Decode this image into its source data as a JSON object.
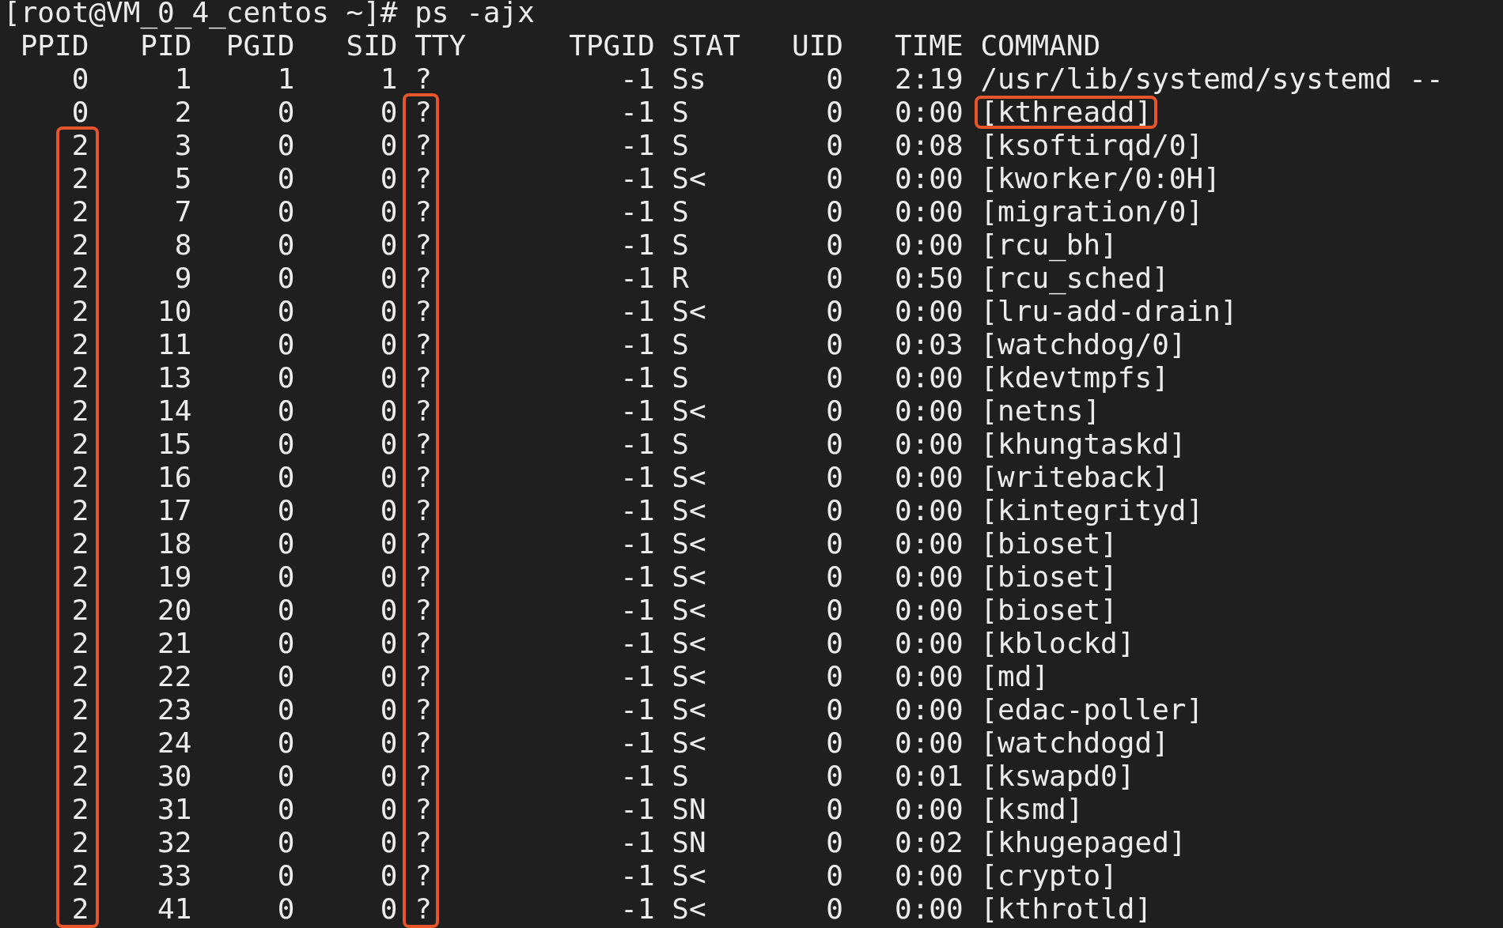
{
  "prompt": "[root@VM_0_4_centos ~]# ps -ajx",
  "columns": [
    "PPID",
    "PID",
    "PGID",
    "SID",
    "TTY",
    "TPGID",
    "STAT",
    "UID",
    "TIME",
    "COMMAND"
  ],
  "rows": [
    {
      "cells": [
        "0",
        "1",
        "1",
        "1",
        "?",
        "-1",
        "Ss",
        "0",
        "2:19",
        "/usr/lib/systemd/systemd --"
      ],
      "ppid_boxed": false,
      "tty_boxed": false,
      "command_boxed": false
    },
    {
      "cells": [
        "0",
        "2",
        "0",
        "0",
        "?",
        "-1",
        "S",
        "0",
        "0:00",
        "[kthreadd]"
      ],
      "ppid_boxed": false,
      "tty_boxed": true,
      "command_boxed": true
    },
    {
      "cells": [
        "2",
        "3",
        "0",
        "0",
        "?",
        "-1",
        "S",
        "0",
        "0:08",
        "[ksoftirqd/0]"
      ],
      "ppid_boxed": true,
      "tty_boxed": true,
      "command_boxed": false
    },
    {
      "cells": [
        "2",
        "5",
        "0",
        "0",
        "?",
        "-1",
        "S<",
        "0",
        "0:00",
        "[kworker/0:0H]"
      ],
      "ppid_boxed": true,
      "tty_boxed": true,
      "command_boxed": false
    },
    {
      "cells": [
        "2",
        "7",
        "0",
        "0",
        "?",
        "-1",
        "S",
        "0",
        "0:00",
        "[migration/0]"
      ],
      "ppid_boxed": true,
      "tty_boxed": true,
      "command_boxed": false
    },
    {
      "cells": [
        "2",
        "8",
        "0",
        "0",
        "?",
        "-1",
        "S",
        "0",
        "0:00",
        "[rcu_bh]"
      ],
      "ppid_boxed": true,
      "tty_boxed": true,
      "command_boxed": false
    },
    {
      "cells": [
        "2",
        "9",
        "0",
        "0",
        "?",
        "-1",
        "R",
        "0",
        "0:50",
        "[rcu_sched]"
      ],
      "ppid_boxed": true,
      "tty_boxed": true,
      "command_boxed": false
    },
    {
      "cells": [
        "2",
        "10",
        "0",
        "0",
        "?",
        "-1",
        "S<",
        "0",
        "0:00",
        "[lru-add-drain]"
      ],
      "ppid_boxed": true,
      "tty_boxed": true,
      "command_boxed": false
    },
    {
      "cells": [
        "2",
        "11",
        "0",
        "0",
        "?",
        "-1",
        "S",
        "0",
        "0:03",
        "[watchdog/0]"
      ],
      "ppid_boxed": true,
      "tty_boxed": true,
      "command_boxed": false
    },
    {
      "cells": [
        "2",
        "13",
        "0",
        "0",
        "?",
        "-1",
        "S",
        "0",
        "0:00",
        "[kdevtmpfs]"
      ],
      "ppid_boxed": true,
      "tty_boxed": true,
      "command_boxed": false
    },
    {
      "cells": [
        "2",
        "14",
        "0",
        "0",
        "?",
        "-1",
        "S<",
        "0",
        "0:00",
        "[netns]"
      ],
      "ppid_boxed": true,
      "tty_boxed": true,
      "command_boxed": false
    },
    {
      "cells": [
        "2",
        "15",
        "0",
        "0",
        "?",
        "-1",
        "S",
        "0",
        "0:00",
        "[khungtaskd]"
      ],
      "ppid_boxed": true,
      "tty_boxed": true,
      "command_boxed": false
    },
    {
      "cells": [
        "2",
        "16",
        "0",
        "0",
        "?",
        "-1",
        "S<",
        "0",
        "0:00",
        "[writeback]"
      ],
      "ppid_boxed": true,
      "tty_boxed": true,
      "command_boxed": false
    },
    {
      "cells": [
        "2",
        "17",
        "0",
        "0",
        "?",
        "-1",
        "S<",
        "0",
        "0:00",
        "[kintegrityd]"
      ],
      "ppid_boxed": true,
      "tty_boxed": true,
      "command_boxed": false
    },
    {
      "cells": [
        "2",
        "18",
        "0",
        "0",
        "?",
        "-1",
        "S<",
        "0",
        "0:00",
        "[bioset]"
      ],
      "ppid_boxed": true,
      "tty_boxed": true,
      "command_boxed": false
    },
    {
      "cells": [
        "2",
        "19",
        "0",
        "0",
        "?",
        "-1",
        "S<",
        "0",
        "0:00",
        "[bioset]"
      ],
      "ppid_boxed": true,
      "tty_boxed": true,
      "command_boxed": false
    },
    {
      "cells": [
        "2",
        "20",
        "0",
        "0",
        "?",
        "-1",
        "S<",
        "0",
        "0:00",
        "[bioset]"
      ],
      "ppid_boxed": true,
      "tty_boxed": true,
      "command_boxed": false
    },
    {
      "cells": [
        "2",
        "21",
        "0",
        "0",
        "?",
        "-1",
        "S<",
        "0",
        "0:00",
        "[kblockd]"
      ],
      "ppid_boxed": true,
      "tty_boxed": true,
      "command_boxed": false
    },
    {
      "cells": [
        "2",
        "22",
        "0",
        "0",
        "?",
        "-1",
        "S<",
        "0",
        "0:00",
        "[md]"
      ],
      "ppid_boxed": true,
      "tty_boxed": true,
      "command_boxed": false
    },
    {
      "cells": [
        "2",
        "23",
        "0",
        "0",
        "?",
        "-1",
        "S<",
        "0",
        "0:00",
        "[edac-poller]"
      ],
      "ppid_boxed": true,
      "tty_boxed": true,
      "command_boxed": false
    },
    {
      "cells": [
        "2",
        "24",
        "0",
        "0",
        "?",
        "-1",
        "S<",
        "0",
        "0:00",
        "[watchdogd]"
      ],
      "ppid_boxed": true,
      "tty_boxed": true,
      "command_boxed": false
    },
    {
      "cells": [
        "2",
        "30",
        "0",
        "0",
        "?",
        "-1",
        "S",
        "0",
        "0:01",
        "[kswapd0]"
      ],
      "ppid_boxed": true,
      "tty_boxed": true,
      "command_boxed": false
    },
    {
      "cells": [
        "2",
        "31",
        "0",
        "0",
        "?",
        "-1",
        "SN",
        "0",
        "0:00",
        "[ksmd]"
      ],
      "ppid_boxed": true,
      "tty_boxed": true,
      "command_boxed": false
    },
    {
      "cells": [
        "2",
        "32",
        "0",
        "0",
        "?",
        "-1",
        "SN",
        "0",
        "0:02",
        "[khugepaged]"
      ],
      "ppid_boxed": true,
      "tty_boxed": true,
      "command_boxed": false
    },
    {
      "cells": [
        "2",
        "33",
        "0",
        "0",
        "?",
        "-1",
        "S<",
        "0",
        "0:00",
        "[crypto]"
      ],
      "ppid_boxed": true,
      "tty_boxed": true,
      "command_boxed": false
    },
    {
      "cells": [
        "2",
        "41",
        "0",
        "0",
        "?",
        "-1",
        "S<",
        "0",
        "0:00",
        "[kthrotld]"
      ],
      "ppid_boxed": true,
      "tty_boxed": true,
      "command_boxed": false
    }
  ]
}
